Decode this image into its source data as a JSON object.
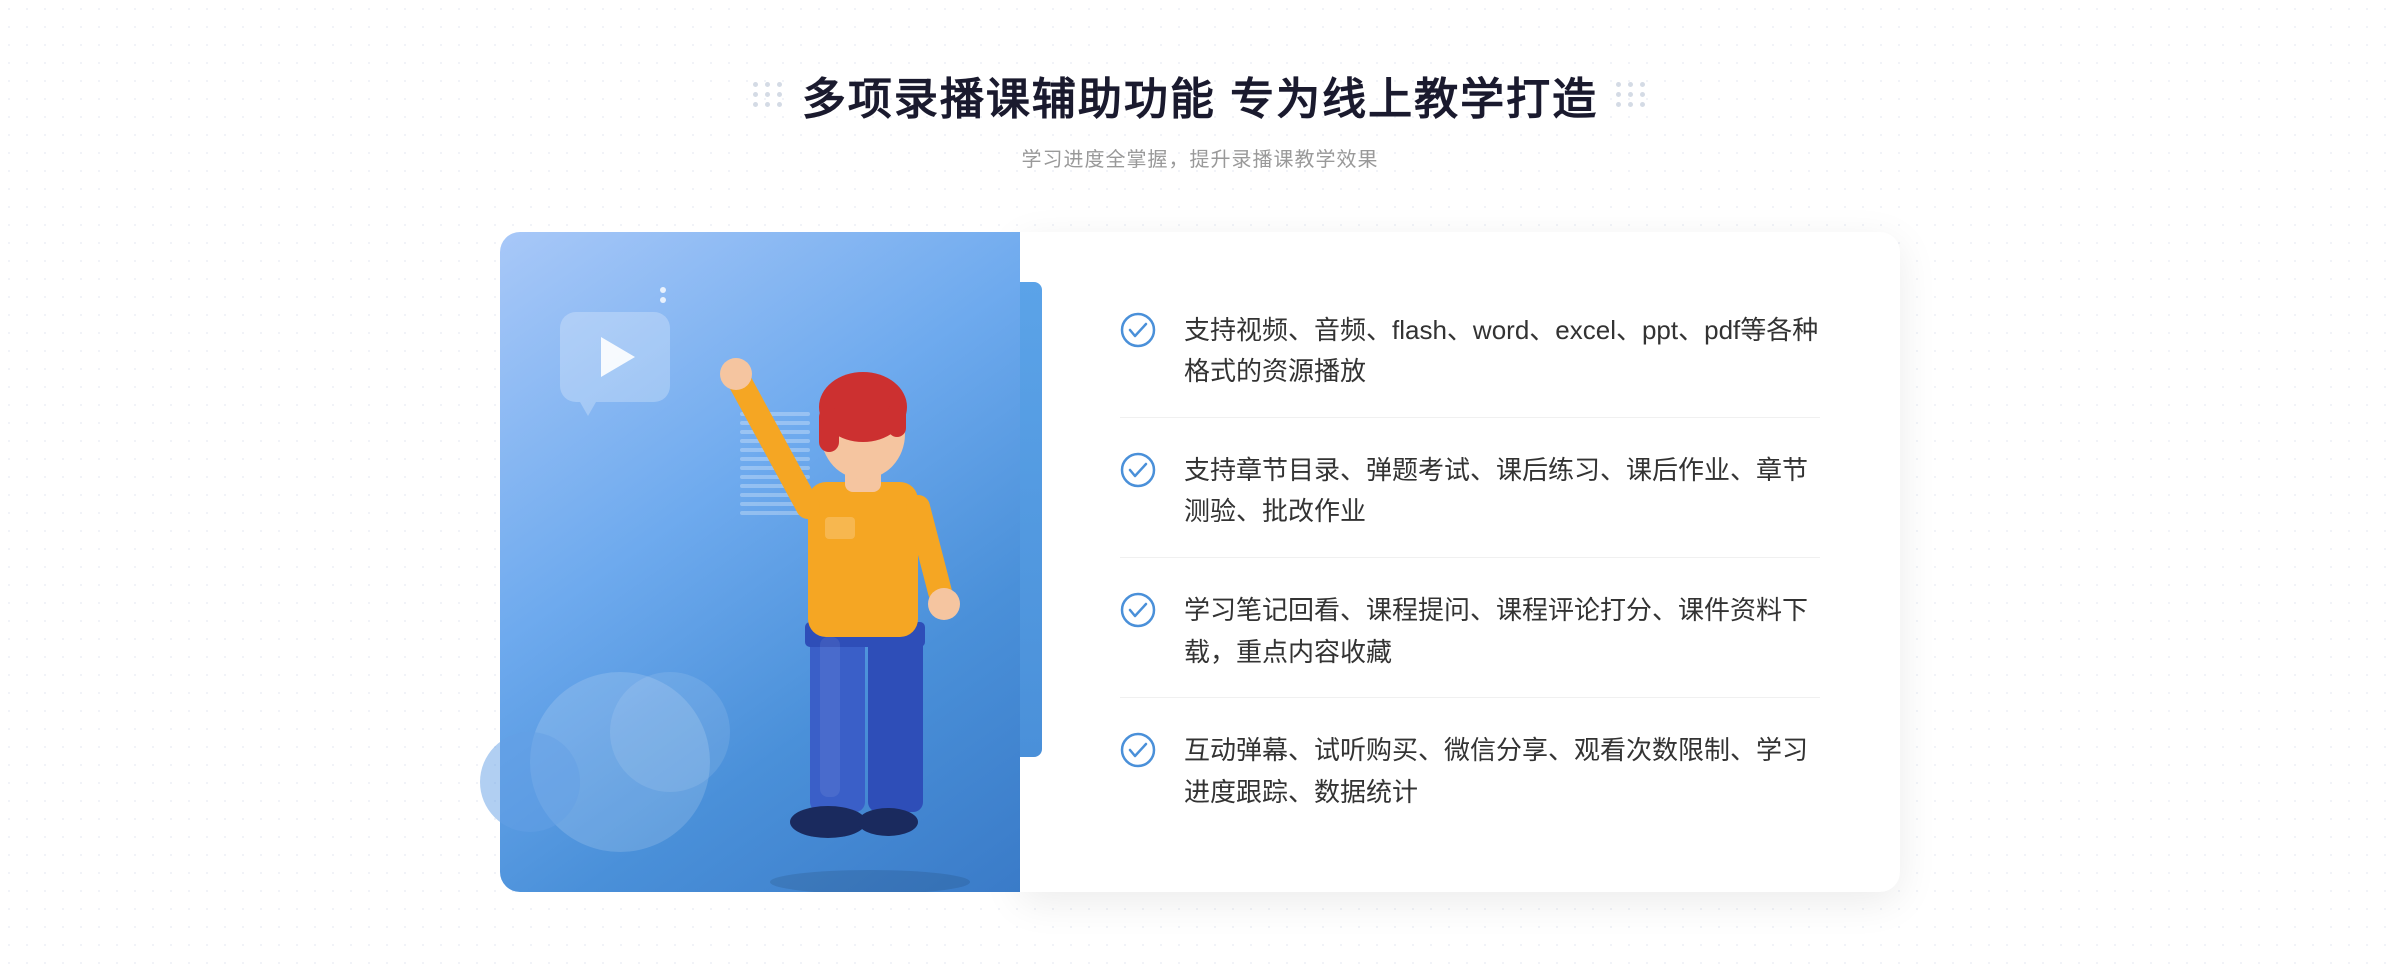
{
  "header": {
    "title": "多项录播课辅助功能 专为线上教学打造",
    "subtitle": "学习进度全掌握，提升录播课教学效果"
  },
  "features": [
    {
      "id": "feature-1",
      "text": "支持视频、音频、flash、word、excel、ppt、pdf等各种格式的资源播放"
    },
    {
      "id": "feature-2",
      "text": "支持章节目录、弹题考试、课后练习、课后作业、章节测验、批改作业"
    },
    {
      "id": "feature-3",
      "text": "学习笔记回看、课程提问、课程评论打分、课件资料下载，重点内容收藏"
    },
    {
      "id": "feature-4",
      "text": "互动弹幕、试听购买、微信分享、观看次数限制、学习进度跟踪、数据统计"
    }
  ],
  "decorations": {
    "left_chevrons": "»",
    "dots_label": "decorative dots"
  }
}
